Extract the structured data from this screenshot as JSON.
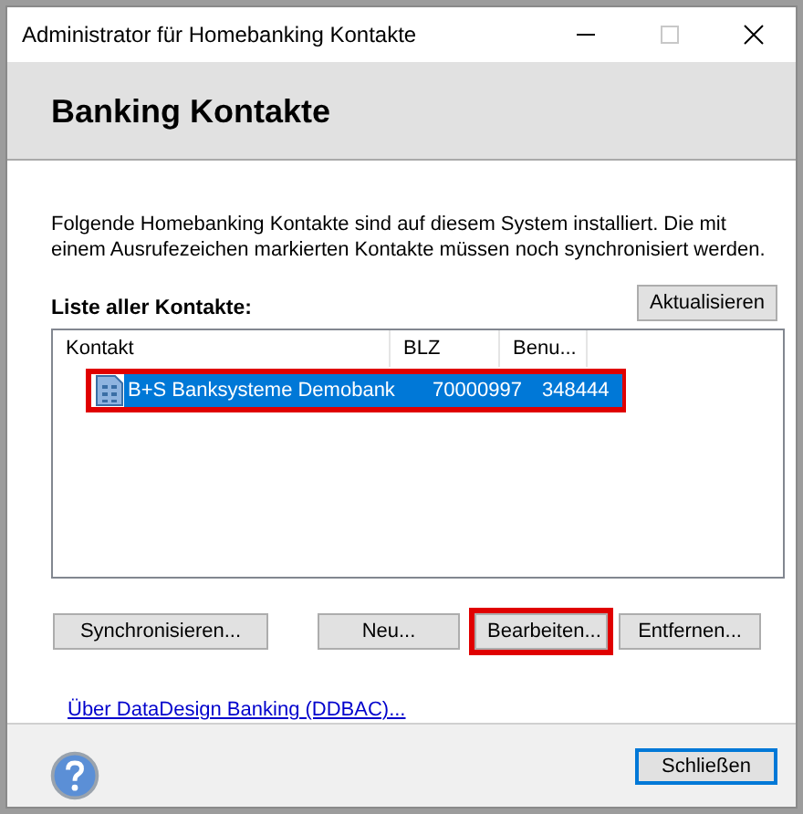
{
  "window": {
    "title": "Administrator für Homebanking Kontakte"
  },
  "header": {
    "title": "Banking Kontakte"
  },
  "intro": "Folgende Homebanking Kontakte sind auf diesem System installiert. Die mit einem Ausrufezeichen markierten Kontakte müssen noch synchronisiert werden.",
  "list_label": "Liste aller Kontakte:",
  "refresh_button": "Aktualisieren",
  "table": {
    "columns": [
      "Kontakt",
      "BLZ",
      "Benu..."
    ],
    "rows": [
      {
        "cells": [
          "B+S Banksysteme Demobank",
          "70000997",
          "348444"
        ],
        "selected": true,
        "highlighted": true
      }
    ]
  },
  "buttons": [
    {
      "label": "Synchronisieren...",
      "highlighted": false
    },
    {
      "label": "Neu...",
      "highlighted": false
    },
    {
      "label": "Bearbeiten...",
      "highlighted": true
    },
    {
      "label": "Entfernen...",
      "highlighted": false
    }
  ],
  "link": "Über DataDesign Banking (DDBAC)...",
  "close_button": "Schließen"
}
